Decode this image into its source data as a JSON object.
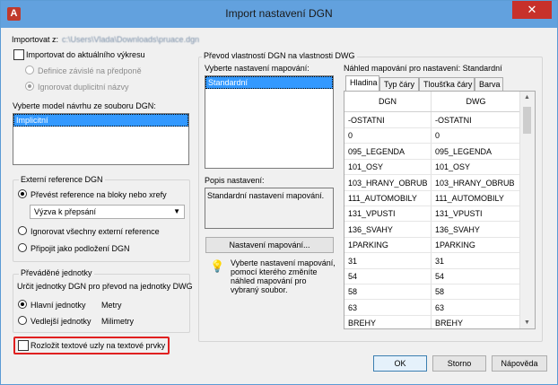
{
  "window": {
    "title": "Import nastavení DGN",
    "app_icon_glyph": "A",
    "close_glyph": "✕"
  },
  "import_path": {
    "label": "Importovat z:",
    "value": "c:\\Users\\Vlada\\Downloads\\pruace.dgn"
  },
  "import_current": {
    "label": "Importovat do aktuálního výkresu",
    "checked": false,
    "options": [
      {
        "label": "Definice závislé na předponě",
        "selected": false
      },
      {
        "label": "Ignorovat duplicitní názvy",
        "selected": true
      }
    ]
  },
  "model_select": {
    "label": "Vyberte model návrhu ze souboru DGN:",
    "items": [
      "Implicitní"
    ]
  },
  "external_refs": {
    "title": "Externí reference DGN",
    "options": [
      {
        "label": "Převést reference na bloky nebo xrefy",
        "selected": true
      },
      {
        "label": "Ignorovat všechny externí reference",
        "selected": false
      },
      {
        "label": "Připojit jako podložení DGN",
        "selected": false
      }
    ],
    "combo_value": "Výzva k přepsání"
  },
  "units": {
    "title": "Převáděné jednotky",
    "description": "Určit jednotky DGN pro převod na jednotky DWG",
    "options": [
      {
        "label": "Hlavní jednotky",
        "value": "Metry",
        "selected": true
      },
      {
        "label": "Vedlejší jednotky",
        "value": "Milimetry",
        "selected": false
      }
    ]
  },
  "explode_text": {
    "label": "Rozložit textové uzly na textové prvky",
    "checked": false
  },
  "mapping": {
    "group_title": "Převod vlastností DGN na vlastnosti DWG",
    "select_label": "Vyberte nastavení mapování:",
    "items": [
      "Standardní"
    ],
    "description_label": "Popis nastavení:",
    "description": "Standardní nastavení mapování.",
    "settings_button": "Nastavení mapování...",
    "tip": "Vyberte nastavení mapování, pomocí kterého změníte náhled mapování pro vybraný soubor."
  },
  "preview": {
    "label": "Náhled mapování pro nastavení: Standardní",
    "tabs": [
      "Hladina",
      "Typ čáry",
      "Tloušťka čáry",
      "Barva"
    ],
    "active_tab": 0,
    "columns": [
      "DGN",
      "DWG"
    ],
    "rows": [
      [
        "-OSTATNI",
        "-OSTATNI"
      ],
      [
        "0",
        "0"
      ],
      [
        "095_LEGENDA",
        "095_LEGENDA"
      ],
      [
        "101_OSY",
        "101_OSY"
      ],
      [
        "103_HRANY_OBRUB",
        "103_HRANY_OBRUB"
      ],
      [
        "111_AUTOMOBILY",
        "111_AUTOMOBILY"
      ],
      [
        "131_VPUSTI",
        "131_VPUSTI"
      ],
      [
        "136_SVAHY",
        "136_SVAHY"
      ],
      [
        "1PARKING",
        "1PARKING"
      ],
      [
        "31",
        "31"
      ],
      [
        "54",
        "54"
      ],
      [
        "58",
        "58"
      ],
      [
        "63",
        "63"
      ],
      [
        "BREHY",
        "BREHY"
      ]
    ]
  },
  "buttons": {
    "ok": "OK",
    "cancel": "Storno",
    "help": "Nápověda"
  },
  "colors": {
    "titlebar": "#62a1de",
    "selection": "#3399ff",
    "highlight_box": "#e02020",
    "close": "#c7312b"
  }
}
